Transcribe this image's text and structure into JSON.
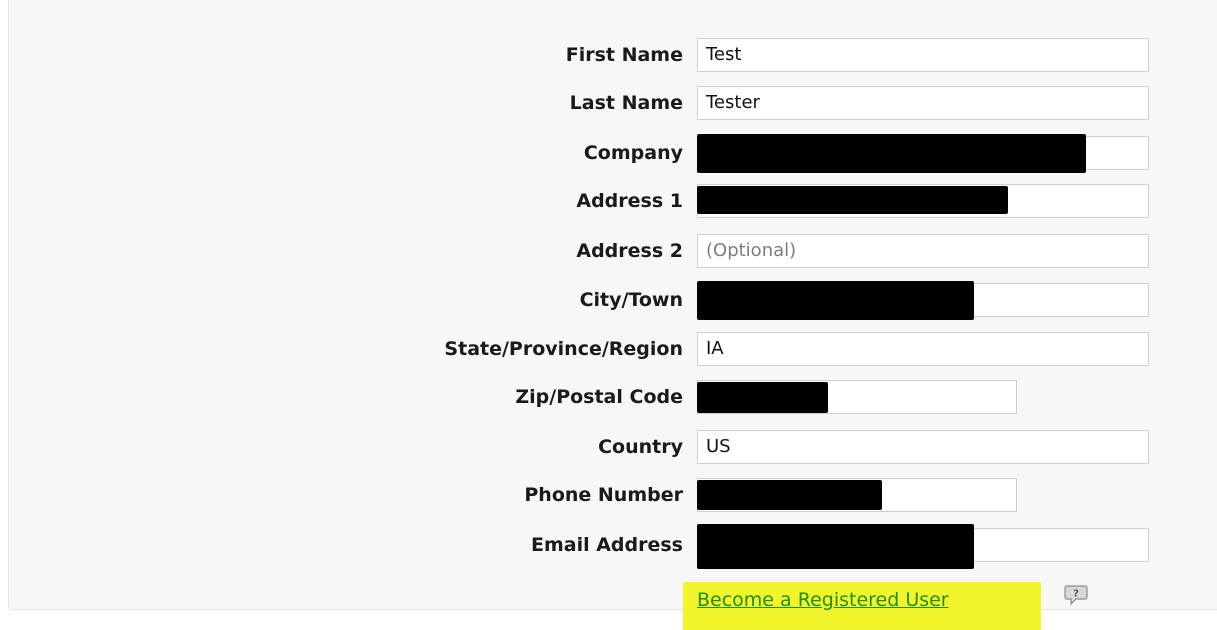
{
  "form": {
    "fields": [
      {
        "label": "First Name",
        "value": "Test"
      },
      {
        "label": "Last Name",
        "value": "Tester"
      },
      {
        "label": "Company",
        "value": ""
      },
      {
        "label": "Address 1",
        "value": ""
      },
      {
        "label": "Address 2",
        "value": "",
        "placeholder": "(Optional)"
      },
      {
        "label": "City/Town",
        "value": ""
      },
      {
        "label": "State/Province/Region",
        "value": "IA"
      },
      {
        "label": "Zip/Postal Code",
        "value": ""
      },
      {
        "label": "Country",
        "value": "US"
      },
      {
        "label": "Phone Number",
        "value": ""
      },
      {
        "label": "Email Address",
        "value": ""
      }
    ],
    "register_link": "Become a Registered User",
    "help_icon": "help-speech-bubble-icon"
  },
  "colors": {
    "highlight": "#f2f52a",
    "link": "#1f8f22",
    "redaction": "#000000"
  }
}
